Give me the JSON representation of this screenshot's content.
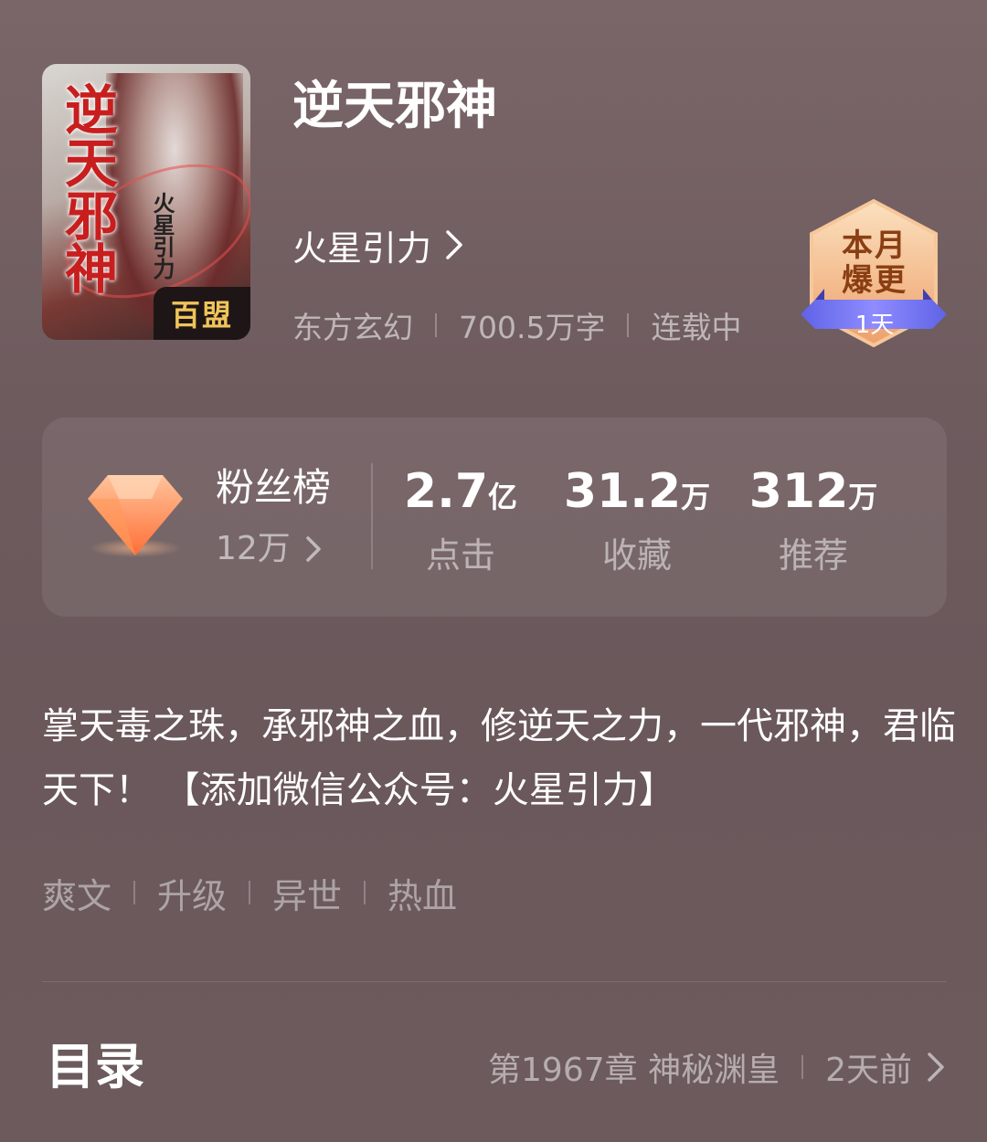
{
  "book": {
    "title": "逆天邪神",
    "author": "火星引力",
    "category": "东方玄幻",
    "word_count": "700.5万字",
    "status": "连载中",
    "cover": {
      "title_art": "逆天邪神",
      "author_art": "火星引力",
      "badge": "百盟"
    }
  },
  "badge": {
    "text": "本月爆更",
    "days": "1天"
  },
  "stats": {
    "fans_label": "粉丝榜",
    "fans_count": "12万",
    "items": [
      {
        "value": "2.7",
        "unit": "亿",
        "label": "点击"
      },
      {
        "value": "31.2",
        "unit": "万",
        "label": "收藏"
      },
      {
        "value": "312",
        "unit": "万",
        "label": "推荐"
      }
    ]
  },
  "description": "掌天毒之珠，承邪神之血，修逆天之力，一代邪神，君临天下！ 【添加微信公众号：火星引力】",
  "tags": [
    "爽文",
    "升级",
    "异世",
    "热血"
  ],
  "catalog": {
    "label": "目录",
    "latest_chapter": "第1967章 神秘渊皇",
    "updated": "2天前"
  },
  "colors": {
    "background": "#6e5b5e",
    "badge_orange": "#f3b77d",
    "ribbon_blue": "#6f6ff0",
    "diamond_orange": "#ff8a4c"
  }
}
